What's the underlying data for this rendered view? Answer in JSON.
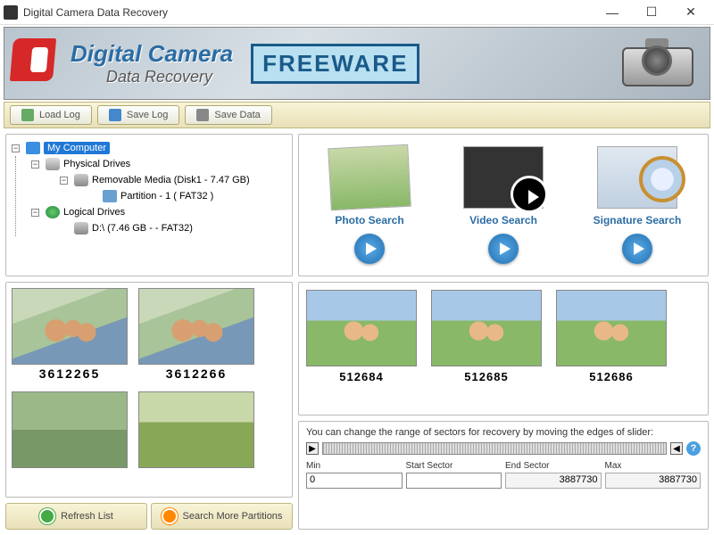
{
  "window": {
    "title": "Digital Camera Data Recovery",
    "min": "—",
    "max": "☐",
    "close": "✕"
  },
  "banner": {
    "line1": "Digital Camera",
    "line2": "Data Recovery",
    "badge": "FREEWARE"
  },
  "toolbar": {
    "load_log": "Load Log",
    "save_log": "Save Log",
    "save_data": "Save Data"
  },
  "tree": {
    "root": "My Computer",
    "physical": "Physical Drives",
    "removable": "Removable Media (Disk1 - 7.47 GB)",
    "partition": "Partition - 1 ( FAT32 )",
    "logical": "Logical Drives",
    "drive_d": "D:\\ (7.46 GB -  - FAT32)"
  },
  "thumbs_left": [
    {
      "id": "3612265"
    },
    {
      "id": "3612266"
    },
    {
      "id": ""
    },
    {
      "id": ""
    }
  ],
  "left_buttons": {
    "refresh": "Refresh List",
    "search_more": "Search More Partitions"
  },
  "search_modes": {
    "photo": "Photo Search",
    "video": "Video Search",
    "signature": "Signature Search"
  },
  "thumbs_right": [
    {
      "id": "512684"
    },
    {
      "id": "512685"
    },
    {
      "id": "512686"
    }
  ],
  "sector": {
    "hint": "You can change the range of sectors for recovery by moving the edges of slider:",
    "min_label": "Min",
    "start_label": "Start Sector",
    "end_label": "End Sector",
    "max_label": "Max",
    "min": "0",
    "start": "",
    "end": "3887730",
    "max": "3887730",
    "help": "?"
  }
}
